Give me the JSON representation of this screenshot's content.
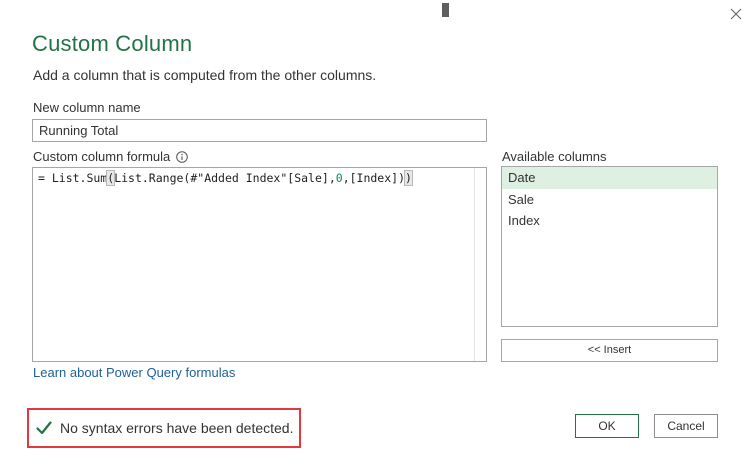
{
  "dialog": {
    "title": "Custom Column",
    "subtitle": "Add a column that is computed from the other columns."
  },
  "new_column": {
    "label": "New column name",
    "value": "Running Total"
  },
  "formula": {
    "label": "Custom column formula",
    "prefix": "= List.Sum",
    "paren_open": "(",
    "mid": "List.Range(#\"Added Index\"[Sale],",
    "zero": "0",
    "end": ",[Index])",
    "paren_close": ")"
  },
  "available_columns": {
    "label": "Available columns",
    "items": [
      "Date",
      "Sale",
      "Index"
    ],
    "selected_index": 0
  },
  "insert_button": "<< Insert",
  "learn_link": "Learn about Power Query formulas",
  "status": {
    "text": "No syntax errors have been detected.",
    "icon": "checkmark-icon",
    "color": "#217346"
  },
  "buttons": {
    "ok": "OK",
    "cancel": "Cancel"
  },
  "colors": {
    "accent": "#217346",
    "highlight_border": "#e0393e",
    "selected_row": "#ddf0e2"
  }
}
